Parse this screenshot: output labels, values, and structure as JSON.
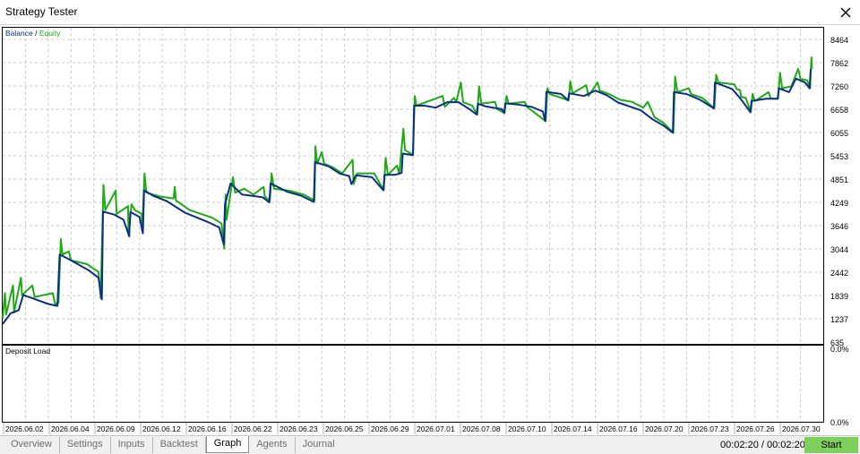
{
  "window": {
    "title": "Strategy Tester",
    "close_icon": "close-icon"
  },
  "colors": {
    "balance": "#0b2f86",
    "equity": "#1faa14",
    "grid": "#c8c8c8",
    "start_button": "#7fcf5c"
  },
  "chart_data": [
    {
      "type": "line",
      "title": "",
      "legend": [
        "Balance",
        "Equity"
      ],
      "legend_placement": "top-left",
      "y_ticks": [
        635,
        1237,
        1839,
        2442,
        3044,
        3646,
        4249,
        4851,
        5453,
        6055,
        6658,
        7260,
        7862,
        8464
      ],
      "ylim": [
        635,
        8464
      ],
      "grid": true,
      "x_categories": [
        "2026.06.02",
        "2026.06.04",
        "2026.06.09",
        "2026.06.12",
        "2026.06.16",
        "2026.06.22",
        "2026.06.23",
        "2026.06.25",
        "2026.06.29",
        "2026.07.01",
        "2026.07.08",
        "2026.07.10",
        "2026.07.14",
        "2026.07.16",
        "2026.07.20",
        "2026.07.23",
        "2026.07.26",
        "2026.07.30"
      ],
      "series": [
        {
          "name": "Balance",
          "points": [
            [
              0,
              1100
            ],
            [
              0.35,
              1380
            ],
            [
              0.7,
              1460
            ],
            [
              0.9,
              1850
            ],
            [
              1.2,
              1790
            ],
            [
              2.0,
              1620
            ],
            [
              2.4,
              1570
            ],
            [
              2.5,
              2900
            ],
            [
              2.9,
              2780
            ],
            [
              3.8,
              2480
            ],
            [
              4.2,
              2300
            ],
            [
              4.35,
              1740
            ],
            [
              4.4,
              4010
            ],
            [
              4.9,
              3930
            ],
            [
              5.3,
              3800
            ],
            [
              5.55,
              3370
            ],
            [
              5.6,
              4000
            ],
            [
              6.0,
              3870
            ],
            [
              6.15,
              3450
            ],
            [
              6.2,
              4560
            ],
            [
              6.6,
              4420
            ],
            [
              7.2,
              4280
            ],
            [
              8.0,
              3980
            ],
            [
              9.0,
              3740
            ],
            [
              9.5,
              3600
            ],
            [
              9.7,
              3160
            ],
            [
              9.75,
              4190
            ],
            [
              10.0,
              4740
            ],
            [
              10.5,
              4450
            ],
            [
              11.4,
              4380
            ],
            [
              11.7,
              4250
            ],
            [
              11.75,
              4740
            ],
            [
              12.5,
              4520
            ],
            [
              13.1,
              4420
            ],
            [
              13.65,
              4260
            ],
            [
              13.7,
              5290
            ],
            [
              14.3,
              5180
            ],
            [
              14.8,
              4990
            ],
            [
              15.2,
              4930
            ],
            [
              15.3,
              4720
            ],
            [
              15.5,
              4950
            ],
            [
              16.2,
              4900
            ],
            [
              16.7,
              4560
            ],
            [
              16.75,
              4960
            ],
            [
              17.2,
              4960
            ],
            [
              17.5,
              5010
            ],
            [
              17.55,
              5510
            ],
            [
              18.0,
              5470
            ],
            [
              18.05,
              6750
            ],
            [
              18.5,
              6750
            ],
            [
              19.0,
              6700
            ],
            [
              19.5,
              6840
            ],
            [
              20.0,
              6840
            ],
            [
              20.5,
              6650
            ],
            [
              20.8,
              6520
            ],
            [
              20.85,
              6800
            ],
            [
              21.2,
              6730
            ],
            [
              21.9,
              6660
            ],
            [
              22.0,
              6560
            ],
            [
              22.05,
              6810
            ],
            [
              22.6,
              6780
            ],
            [
              23.2,
              6720
            ],
            [
              23.7,
              6600
            ],
            [
              23.8,
              6350
            ],
            [
              23.85,
              7110
            ],
            [
              24.5,
              7050
            ],
            [
              24.8,
              6890
            ],
            [
              24.85,
              7070
            ],
            [
              25.5,
              7000
            ],
            [
              26.0,
              7140
            ],
            [
              26.5,
              7020
            ],
            [
              27.0,
              6830
            ],
            [
              28.0,
              6630
            ],
            [
              28.5,
              6400
            ],
            [
              29.0,
              6230
            ],
            [
              29.4,
              6050
            ],
            [
              29.45,
              7100
            ],
            [
              30.0,
              7050
            ],
            [
              30.6,
              6900
            ],
            [
              31.2,
              6680
            ],
            [
              31.25,
              7350
            ],
            [
              32.0,
              7180
            ],
            [
              32.3,
              6980
            ],
            [
              32.5,
              6830
            ],
            [
              32.8,
              6580
            ],
            [
              32.85,
              6870
            ],
            [
              33.5,
              6930
            ],
            [
              34.0,
              6930
            ],
            [
              34.05,
              7200
            ],
            [
              34.5,
              7100
            ],
            [
              34.8,
              7450
            ],
            [
              35.2,
              7350
            ],
            [
              35.4,
              7200
            ],
            [
              35.45,
              7700
            ]
          ]
        },
        {
          "name": "Equity",
          "points": [
            [
              0,
              1250
            ],
            [
              0.1,
              1900
            ],
            [
              0.15,
              1350
            ],
            [
              0.45,
              2100
            ],
            [
              0.5,
              1400
            ],
            [
              0.8,
              2300
            ],
            [
              0.85,
              1850
            ],
            [
              1.3,
              2100
            ],
            [
              1.4,
              1800
            ],
            [
              2.2,
              1900
            ],
            [
              2.3,
              1620
            ],
            [
              2.45,
              1650
            ],
            [
              2.55,
              3300
            ],
            [
              2.62,
              2900
            ],
            [
              2.9,
              2980
            ],
            [
              3.0,
              2750
            ],
            [
              3.7,
              2650
            ],
            [
              4.2,
              2450
            ],
            [
              4.3,
              1770
            ],
            [
              4.42,
              4700
            ],
            [
              4.5,
              4050
            ],
            [
              4.95,
              4550
            ],
            [
              5.0,
              3950
            ],
            [
              5.5,
              4150
            ],
            [
              5.52,
              3400
            ],
            [
              5.65,
              4200
            ],
            [
              5.8,
              4050
            ],
            [
              6.1,
              3950
            ],
            [
              6.12,
              3500
            ],
            [
              6.22,
              5000
            ],
            [
              6.3,
              4500
            ],
            [
              6.9,
              4400
            ],
            [
              7.5,
              4350
            ],
            [
              7.55,
              4650
            ],
            [
              7.6,
              4300
            ],
            [
              8.2,
              4050
            ],
            [
              9.2,
              3850
            ],
            [
              9.6,
              3700
            ],
            [
              9.72,
              3050
            ],
            [
              9.78,
              4450
            ],
            [
              9.82,
              3800
            ],
            [
              10.1,
              4900
            ],
            [
              10.2,
              4500
            ],
            [
              10.6,
              4600
            ],
            [
              11.0,
              4450
            ],
            [
              11.45,
              4650
            ],
            [
              11.5,
              4400
            ],
            [
              11.72,
              4300
            ],
            [
              11.8,
              5000
            ],
            [
              11.9,
              4600
            ],
            [
              12.6,
              4550
            ],
            [
              13.2,
              4450
            ],
            [
              13.68,
              4300
            ],
            [
              13.72,
              5700
            ],
            [
              13.8,
              5250
            ],
            [
              14.0,
              5550
            ],
            [
              14.1,
              5250
            ],
            [
              14.5,
              5150
            ],
            [
              14.9,
              5000
            ],
            [
              15.35,
              5350
            ],
            [
              15.4,
              4720
            ],
            [
              15.55,
              5000
            ],
            [
              16.3,
              5000
            ],
            [
              16.72,
              4560
            ],
            [
              16.8,
              5400
            ],
            [
              16.9,
              4960
            ],
            [
              17.3,
              5200
            ],
            [
              17.4,
              4980
            ],
            [
              17.58,
              6150
            ],
            [
              17.65,
              5600
            ],
            [
              18.0,
              5480
            ],
            [
              18.08,
              7000
            ],
            [
              18.15,
              6750
            ],
            [
              19.3,
              7000
            ],
            [
              19.4,
              6720
            ],
            [
              19.8,
              6950
            ],
            [
              19.9,
              6840
            ],
            [
              20.1,
              7350
            ],
            [
              20.2,
              6840
            ],
            [
              20.6,
              6750
            ],
            [
              20.82,
              6520
            ],
            [
              20.9,
              7250
            ],
            [
              21.0,
              6800
            ],
            [
              21.6,
              6850
            ],
            [
              21.7,
              6660
            ],
            [
              22.02,
              6560
            ],
            [
              22.1,
              7000
            ],
            [
              22.2,
              6800
            ],
            [
              22.9,
              6850
            ],
            [
              23.0,
              6720
            ],
            [
              23.82,
              6350
            ],
            [
              23.9,
              7200
            ],
            [
              24.0,
              7050
            ],
            [
              24.83,
              6890
            ],
            [
              24.9,
              7380
            ],
            [
              25.0,
              7070
            ],
            [
              25.6,
              7280
            ],
            [
              25.7,
              7000
            ],
            [
              26.1,
              7350
            ],
            [
              26.2,
              7140
            ],
            [
              26.6,
              7050
            ],
            [
              27.1,
              6900
            ],
            [
              27.6,
              6850
            ],
            [
              28.1,
              6700
            ],
            [
              28.3,
              6850
            ],
            [
              28.6,
              6450
            ],
            [
              29.0,
              6300
            ],
            [
              29.42,
              6050
            ],
            [
              29.5,
              7500
            ],
            [
              29.6,
              7100
            ],
            [
              30.1,
              7200
            ],
            [
              30.2,
              7050
            ],
            [
              30.7,
              6950
            ],
            [
              31.22,
              6680
            ],
            [
              31.3,
              7550
            ],
            [
              31.4,
              7350
            ],
            [
              32.1,
              7300
            ],
            [
              32.2,
              7180
            ],
            [
              32.35,
              7150
            ],
            [
              32.4,
              6980
            ],
            [
              32.6,
              6950
            ],
            [
              32.82,
              6580
            ],
            [
              32.9,
              7050
            ],
            [
              33.0,
              6870
            ],
            [
              33.6,
              7100
            ],
            [
              33.7,
              6930
            ],
            [
              34.02,
              6930
            ],
            [
              34.1,
              7600
            ],
            [
              34.2,
              7200
            ],
            [
              34.6,
              7250
            ],
            [
              34.9,
              7700
            ],
            [
              35.0,
              7450
            ],
            [
              35.3,
              7400
            ],
            [
              35.42,
              7200
            ],
            [
              35.48,
              8000
            ],
            [
              35.5,
              7700
            ]
          ]
        }
      ]
    },
    {
      "type": "bar",
      "title": "Deposit Load",
      "y_ticks": [
        "0.0%",
        "0.0%"
      ],
      "values": []
    }
  ],
  "tabs": [
    {
      "label": "Overview",
      "active": false
    },
    {
      "label": "Settings",
      "active": false
    },
    {
      "label": "Inputs",
      "active": false
    },
    {
      "label": "Backtest",
      "active": false
    },
    {
      "label": "Graph",
      "active": true
    },
    {
      "label": "Agents",
      "active": false
    },
    {
      "label": "Journal",
      "active": false
    }
  ],
  "status": {
    "time": "00:02:20 / 00:02:20",
    "start_label": "Start"
  }
}
